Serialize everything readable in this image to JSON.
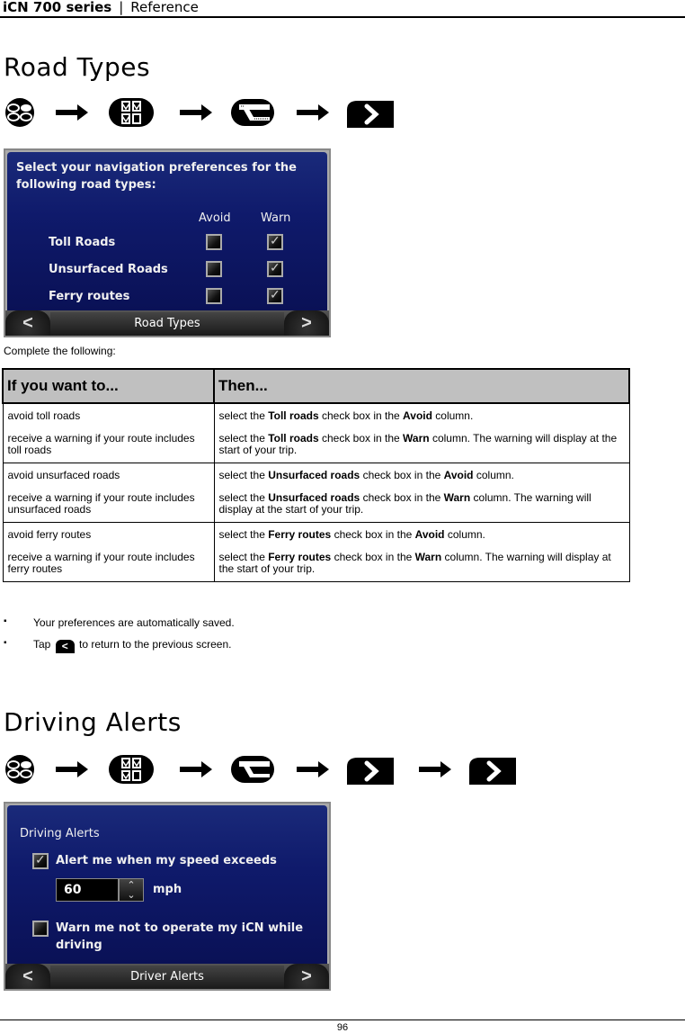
{
  "header": {
    "product": "iCN 700 series",
    "separator": "|",
    "section": "Reference"
  },
  "road_types": {
    "title": "Road Types",
    "nav_path": [
      "menu-icon",
      "preferences-icon",
      "route-icon",
      "next-icon"
    ],
    "screen": {
      "prompt_line1": "Select your navigation preferences for the",
      "prompt_line2": "following road types:",
      "col_avoid": "Avoid",
      "col_warn": "Warn",
      "rows": [
        {
          "label": "Toll Roads",
          "avoid": false,
          "warn": true
        },
        {
          "label": "Unsurfaced Roads",
          "avoid": false,
          "warn": true
        },
        {
          "label": "Ferry routes",
          "avoid": false,
          "warn": true
        }
      ],
      "bar_title": "Road Types",
      "back_glyph": "<",
      "next_glyph": ">"
    },
    "caption": "Complete the following:",
    "table": {
      "headers": [
        "If you want to...",
        "Then..."
      ],
      "rows": [
        {
          "want": [
            "avoid toll roads",
            "receive a warning if your route includes toll roads"
          ],
          "then": [
            {
              "pre": "select the ",
              "b1": "Toll roads",
              "mid": " check box in the ",
              "b2": "Avoid",
              "post": " column."
            },
            {
              "pre": "select the ",
              "b1": "Toll roads",
              "mid": " check box in the ",
              "b2": "Warn",
              "post": " column. The warning will display at the start of your trip."
            }
          ]
        },
        {
          "want": [
            "avoid unsurfaced roads",
            "receive a warning if your route includes unsurfaced roads"
          ],
          "then": [
            {
              "pre": "select the ",
              "b1": "Unsurfaced roads",
              "mid": " check box in the ",
              "b2": "Avoid",
              "post": " column."
            },
            {
              "pre": "select the ",
              "b1": "Unsurfaced roads",
              "mid": " check box in the ",
              "b2": "Warn",
              "post": " column. The warning will display at the start of your trip."
            }
          ]
        },
        {
          "want": [
            "avoid ferry routes",
            "receive a warning if your route includes ferry routes"
          ],
          "then": [
            {
              "pre": "select the ",
              "b1": "Ferry routes",
              "mid": " check box in the ",
              "b2": "Avoid",
              "post": " column."
            },
            {
              "pre": "select the ",
              "b1": "Ferry routes",
              "mid": " check box in the ",
              "b2": "Warn",
              "post": " column. The warning will display at the start of your trip."
            }
          ]
        }
      ]
    },
    "bullets": {
      "saved": "Your preferences are automatically saved.",
      "tap_pre": "Tap",
      "tap_glyph": "<",
      "tap_post": "to return to the previous screen."
    }
  },
  "driving_alerts": {
    "title": "Driving Alerts",
    "nav_path": [
      "menu-icon",
      "preferences-icon",
      "route-icon",
      "next-icon",
      "next-icon"
    ],
    "screen": {
      "heading": "Driving Alerts",
      "speed_alert_label": "Alert me when my speed exceeds",
      "speed_alert_checked": true,
      "speed_value": "60",
      "speed_unit": "mph",
      "warn_label_line1": "Warn me not to operate my iCN while",
      "warn_label_line2": "driving",
      "warn_checked": false,
      "bar_title": "Driver Alerts",
      "back_glyph": "<",
      "next_glyph": ">"
    }
  },
  "footer": {
    "page_number": "96"
  }
}
